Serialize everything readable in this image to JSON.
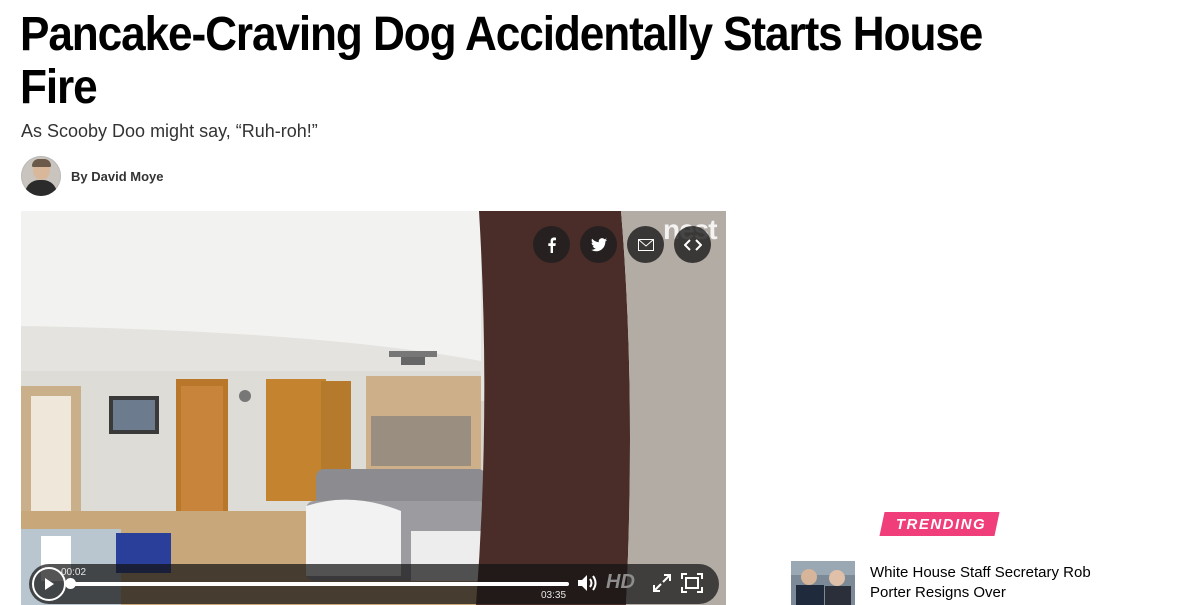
{
  "article": {
    "headline": "Pancake-Craving Dog Accidentally Starts House Fire",
    "subhead": "As Scooby Doo might say, “Ruh-roh!”",
    "author": "By David Moye"
  },
  "video": {
    "watermark": "nest",
    "share_buttons": [
      {
        "name": "facebook",
        "icon": "facebook-icon"
      },
      {
        "name": "twitter",
        "icon": "twitter-icon"
      },
      {
        "name": "email",
        "icon": "email-icon"
      },
      {
        "name": "embed",
        "icon": "embed-icon"
      }
    ],
    "current_time": "00:02",
    "duration": "03:35",
    "progress_fraction": 0.01,
    "quality_label": "HD",
    "icons": [
      "play-icon",
      "volume-icon",
      "popout-icon",
      "fullscreen-icon"
    ]
  },
  "trending": {
    "label": "TRENDING",
    "items": [
      {
        "title": "White House Staff Secretary Rob Porter Resigns Over"
      }
    ]
  },
  "colors": {
    "trending_accent": "#f03e7a",
    "headline": "#000000",
    "controls_bg": "#141414"
  }
}
